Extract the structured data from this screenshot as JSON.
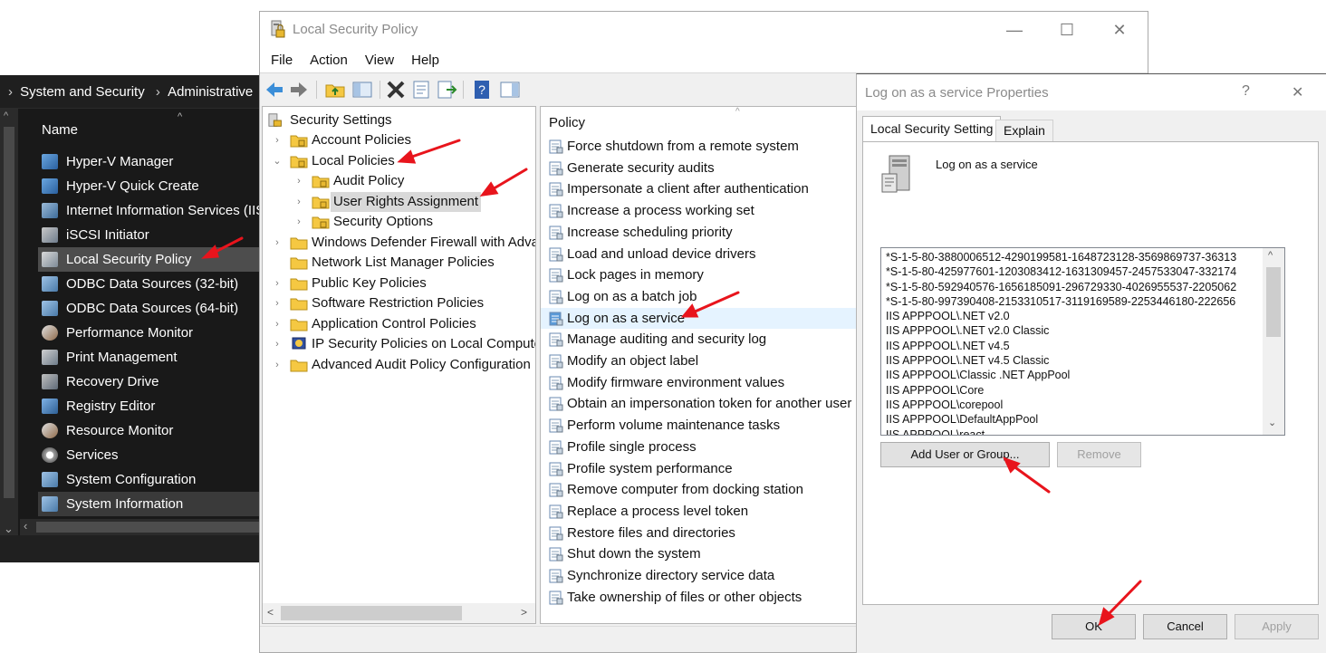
{
  "explorer": {
    "breadcrumb": [
      "System and Security",
      "Administrative"
    ],
    "column_header": "Name",
    "items": [
      {
        "label": "Hyper-V Manager",
        "icon": "hyper-v-icon"
      },
      {
        "label": "Hyper-V Quick Create",
        "icon": "hyper-v-icon"
      },
      {
        "label": "Internet Information Services (IIS",
        "icon": "iis-icon"
      },
      {
        "label": "iSCSI Initiator",
        "icon": "iscsi-icon"
      },
      {
        "label": "Local Security Policy",
        "icon": "security-policy-icon"
      },
      {
        "label": "ODBC Data Sources (32-bit)",
        "icon": "odbc-icon"
      },
      {
        "label": "ODBC Data Sources (64-bit)",
        "icon": "odbc-icon"
      },
      {
        "label": "Performance Monitor",
        "icon": "performance-icon"
      },
      {
        "label": "Print Management",
        "icon": "printer-icon"
      },
      {
        "label": "Recovery Drive",
        "icon": "drive-icon"
      },
      {
        "label": "Registry Editor",
        "icon": "registry-icon"
      },
      {
        "label": "Resource Monitor",
        "icon": "monitor-icon"
      },
      {
        "label": "Services",
        "icon": "gear-icon"
      },
      {
        "label": "System Configuration",
        "icon": "config-icon"
      },
      {
        "label": "System Information",
        "icon": "info-icon"
      }
    ]
  },
  "lsp": {
    "title": "Local Security Policy",
    "caption": {
      "minimize": "—",
      "maximize": "☐",
      "close": "✕"
    },
    "menu": [
      "File",
      "Action",
      "View",
      "Help"
    ],
    "tree": {
      "root": "Security Settings",
      "nodes": [
        {
          "label": "Account Policies",
          "exp": "›"
        },
        {
          "label": "Local Policies",
          "exp": "⌄"
        },
        {
          "label": "Audit Policy",
          "exp": "›"
        },
        {
          "label": "User Rights Assignment",
          "exp": "›"
        },
        {
          "label": "Security Options",
          "exp": "›"
        },
        {
          "label": "Windows Defender Firewall with Advai",
          "exp": "›"
        },
        {
          "label": "Network List Manager Policies",
          "exp": ""
        },
        {
          "label": "Public Key Policies",
          "exp": "›"
        },
        {
          "label": "Software Restriction Policies",
          "exp": "›"
        },
        {
          "label": "Application Control Policies",
          "exp": "›"
        },
        {
          "label": "IP Security Policies on Local Computer",
          "exp": "›"
        },
        {
          "label": "Advanced Audit Policy Configuration",
          "exp": "›"
        }
      ]
    },
    "list": {
      "header": "Policy",
      "rows": [
        "Force shutdown from a remote system",
        "Generate security audits",
        "Impersonate a client after authentication",
        "Increase a process working set",
        "Increase scheduling priority",
        "Load and unload device drivers",
        "Lock pages in memory",
        "Log on as a batch job",
        "Log on as a service",
        "Manage auditing and security log",
        "Modify an object label",
        "Modify firmware environment values",
        "Obtain an impersonation token for another user i",
        "Perform volume maintenance tasks",
        "Profile single process",
        "Profile system performance",
        "Remove computer from docking station",
        "Replace a process level token",
        "Restore files and directories",
        "Shut down the system",
        "Synchronize directory service data",
        "Take ownership of files or other objects"
      ]
    }
  },
  "props": {
    "title": "Log on as a service Properties",
    "help": "?",
    "close": "✕",
    "tabs": [
      "Local Security Setting",
      "Explain"
    ],
    "heading": "Log on as a service",
    "accounts": [
      "*S-1-5-80-3880006512-4290199581-1648723128-3569869737-36313",
      "*S-1-5-80-425977601-1203083412-1631309457-2457533047-332174",
      "*S-1-5-80-592940576-1656185091-296729330-4026955537-2205062",
      "*S-1-5-80-997390408-2153310517-3119169589-2253446180-222656",
      "IIS APPPOOL\\.NET v2.0",
      "IIS APPPOOL\\.NET v2.0 Classic",
      "IIS APPPOOL\\.NET v4.5",
      "IIS APPPOOL\\.NET v4.5 Classic",
      "IIS APPPOOL\\Classic .NET AppPool",
      "IIS APPPOOL\\Core",
      "IIS APPPOOL\\corepool",
      "IIS APPPOOL\\DefaultAppPool",
      "IIS APPPOOL\\react"
    ],
    "buttons": {
      "add": "Add User or Group...",
      "remove": "Remove",
      "ok": "OK",
      "cancel": "Cancel",
      "apply": "Apply"
    }
  },
  "colors": {
    "arrow": "#e8141c",
    "folder": "#f5c842",
    "selection": "#e5f3ff"
  }
}
